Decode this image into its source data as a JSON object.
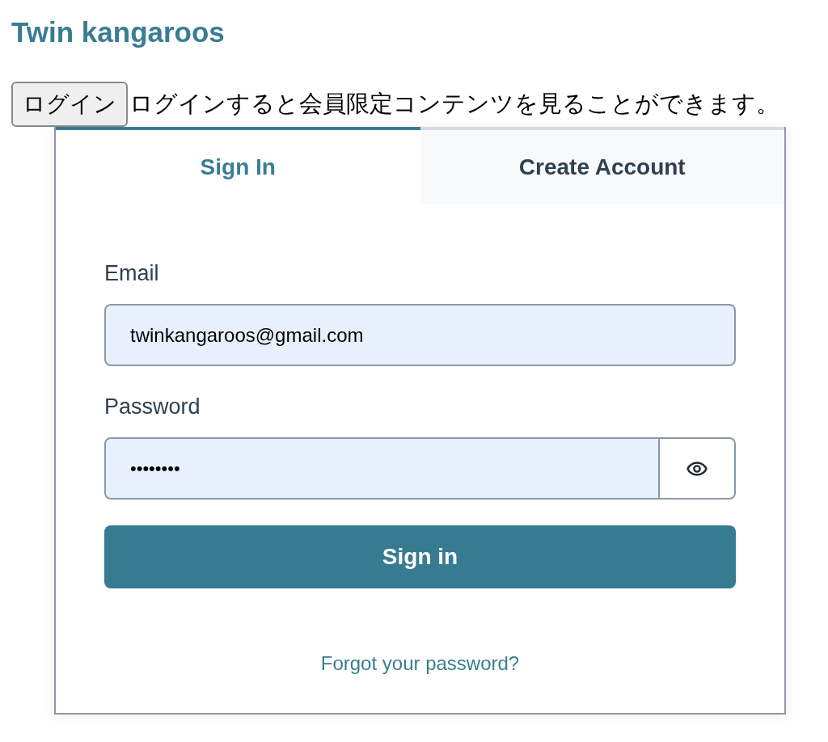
{
  "heading": "Twin kangaroos",
  "login_button": "ログイン",
  "login_note": "ログインすると会員限定コンテンツを見ることができます。",
  "tabs": [
    {
      "label": "Sign In",
      "selected": true
    },
    {
      "label": "Create Account",
      "selected": false
    }
  ],
  "form": {
    "fields": [
      {
        "kind": "text",
        "label": "Email",
        "value": "twinkangaroos@gmail.com"
      },
      {
        "kind": "password",
        "label": "Password",
        "value": "••••••••"
      }
    ],
    "submit": "Sign in",
    "forgot_link": "Forgot your password?"
  }
}
